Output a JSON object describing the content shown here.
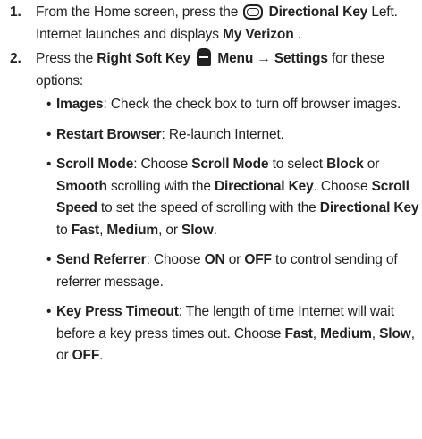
{
  "steps": [
    {
      "number": "1.",
      "t1": "From the Home screen, press the",
      "icon": "directional-key-icon",
      "k1": "Directional Key",
      "t2": " Left. Internet launches and displays ",
      "k2": "My Verizon",
      "t3": "."
    },
    {
      "number": "2.",
      "t1": "Press the ",
      "k1": "Right Soft Key",
      "icon": "right-soft-key-icon",
      "k2": "Menu → Settings",
      "t2": " for these options:"
    }
  ],
  "options": [
    {
      "bullet": "•",
      "name": "Images",
      "t1": ": Check the check box to turn off browser images."
    },
    {
      "bullet": "•",
      "name": "Restart Browser",
      "t1": ": Re-launch Internet."
    },
    {
      "bullet": "•",
      "name": "Scroll Mode",
      "t1": ": Choose ",
      "b1": "Scroll Mode",
      "t2": " to select ",
      "b2": "Block",
      "t3": " or ",
      "b3": "Smooth",
      "t4": " scrolling with the ",
      "b4": "Directional Key",
      "t5": ". Choose ",
      "b5": "Scroll Speed",
      "t6": " to set the speed of scrolling with the ",
      "b6": "Directional Key",
      "t7": " to ",
      "b7": "Fast",
      "t8": ", ",
      "b8": "Medium",
      "t9": ", or ",
      "b9": "Slow",
      "t10": "."
    },
    {
      "bullet": "•",
      "name": "Send Referrer",
      "t1": ": Choose ",
      "b1": "ON",
      "t2": " or ",
      "b2": "OFF",
      "t3": " to control sending of referrer message."
    },
    {
      "bullet": "•",
      "name": "Key Press Timeout",
      "t1": ": The length of time Internet will wait before a key press times out. Choose ",
      "b1": "Fast",
      "t2": ", ",
      "b2": "Medium",
      "t3": ", ",
      "b3": "Slow",
      "t4": ", or ",
      "b4": "OFF",
      "t5": "."
    }
  ]
}
